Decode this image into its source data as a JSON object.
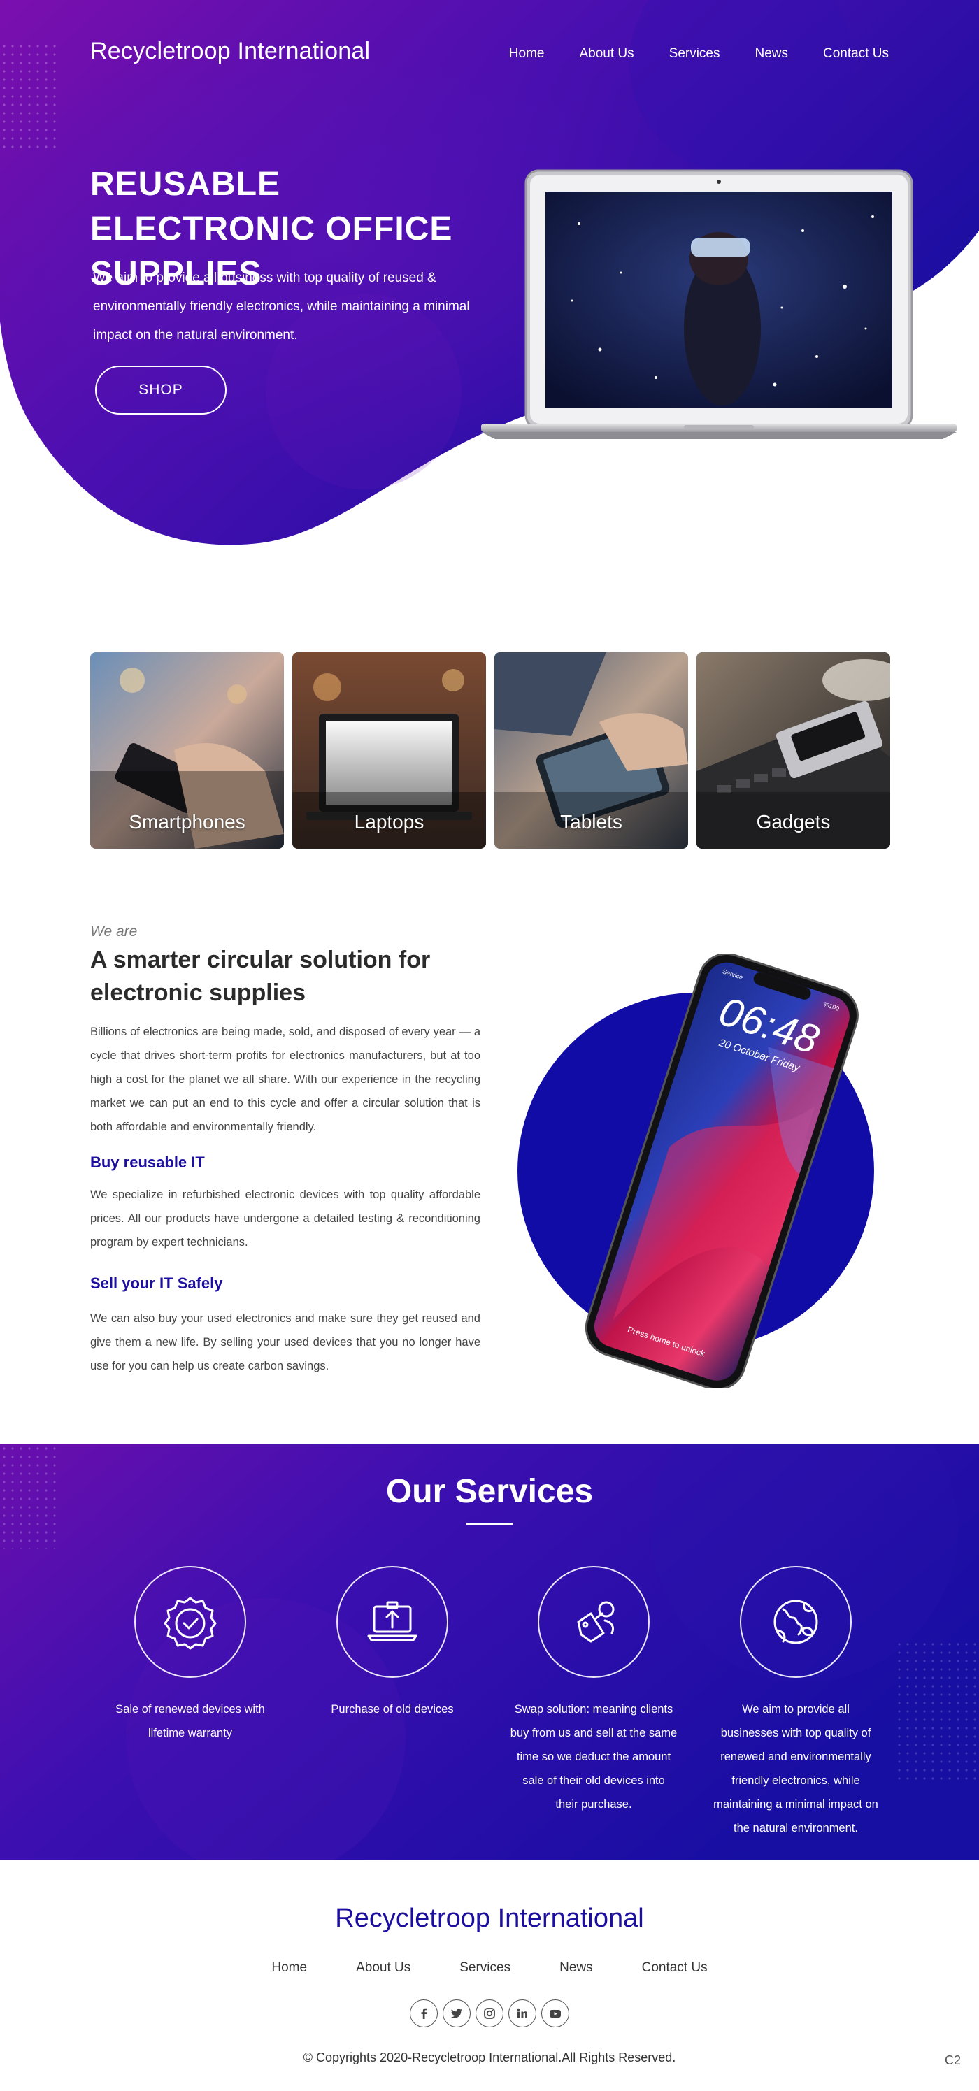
{
  "colors": {
    "brand": "#1c0fa0",
    "hero_purple": "#7a0fae",
    "hero_blue": "#1f0ea6",
    "circle_blue": "#120ca6"
  },
  "nav": {
    "brand": "Recycletroop International",
    "links": [
      "Home",
      "About Us",
      "Services",
      "News",
      "Contact Us"
    ]
  },
  "hero": {
    "title": "REUSABLE ELECTRONIC OFFICE SUPPLIES",
    "subtitle": "We aim to provide all business with top quality of reused & environmentally friendly electronics, while maintaining a minimal impact on the natural environment.",
    "button": "SHOP"
  },
  "categories": [
    {
      "label": "Smartphones"
    },
    {
      "label": "Laptops"
    },
    {
      "label": "Tablets"
    },
    {
      "label": "Gadgets"
    }
  ],
  "about": {
    "kicker": "We are",
    "title": "A smarter circular solution for electronic supplies",
    "intro": "Billions of electronics are being made, sold, and disposed of every year — a cycle that drives short-term profits for electronics manufacturers, but at too high a cost for the planet we all share. With our experience in the recycling market we can put an end to this cycle and offer a circular solution that is both affordable and environmentally friendly.",
    "buy_heading": "Buy reusable IT",
    "buy_text": "We specialize in refurbished electronic devices with top quality affordable prices. All our products have undergone a detailed testing & reconditioning program by expert technicians.",
    "sell_heading": "Sell your IT Safely",
    "sell_text": "We can also buy your used electronics and make sure they get reused and give them a new life. By selling your used devices that you no longer have use for you can help us create carbon savings.",
    "phone": {
      "time": "06:48",
      "date": "20 October Friday",
      "unlock": "Press home to unlock",
      "carrier": "Service",
      "battery": "%100"
    }
  },
  "services": {
    "title": "Our Services",
    "items": [
      {
        "icon": "badge-check-icon",
        "text": "Sale of renewed devices with lifetime warranty"
      },
      {
        "icon": "laptop-upload-icon",
        "text": "Purchase of old devices"
      },
      {
        "icon": "swap-tag-icon",
        "text": "Swap solution: meaning clients buy from us and sell at the same time so we deduct the amount sale of their old devices into their purchase."
      },
      {
        "icon": "globe-leaf-icon",
        "text": "We aim to provide all businesses with top quality of renewed and environmentally friendly electronics, while maintaining a minimal impact on the natural environment."
      }
    ]
  },
  "footer": {
    "brand": "Recycletroop International",
    "links": [
      "Home",
      "About Us",
      "Services",
      "News",
      "Contact Us"
    ],
    "socials": [
      "facebook-icon",
      "twitter-icon",
      "instagram-icon",
      "linkedin-icon",
      "youtube-icon"
    ],
    "copyright": "© Copyrights 2020-Recycletroop International.All Rights Reserved.",
    "corner_tag": "C2"
  }
}
